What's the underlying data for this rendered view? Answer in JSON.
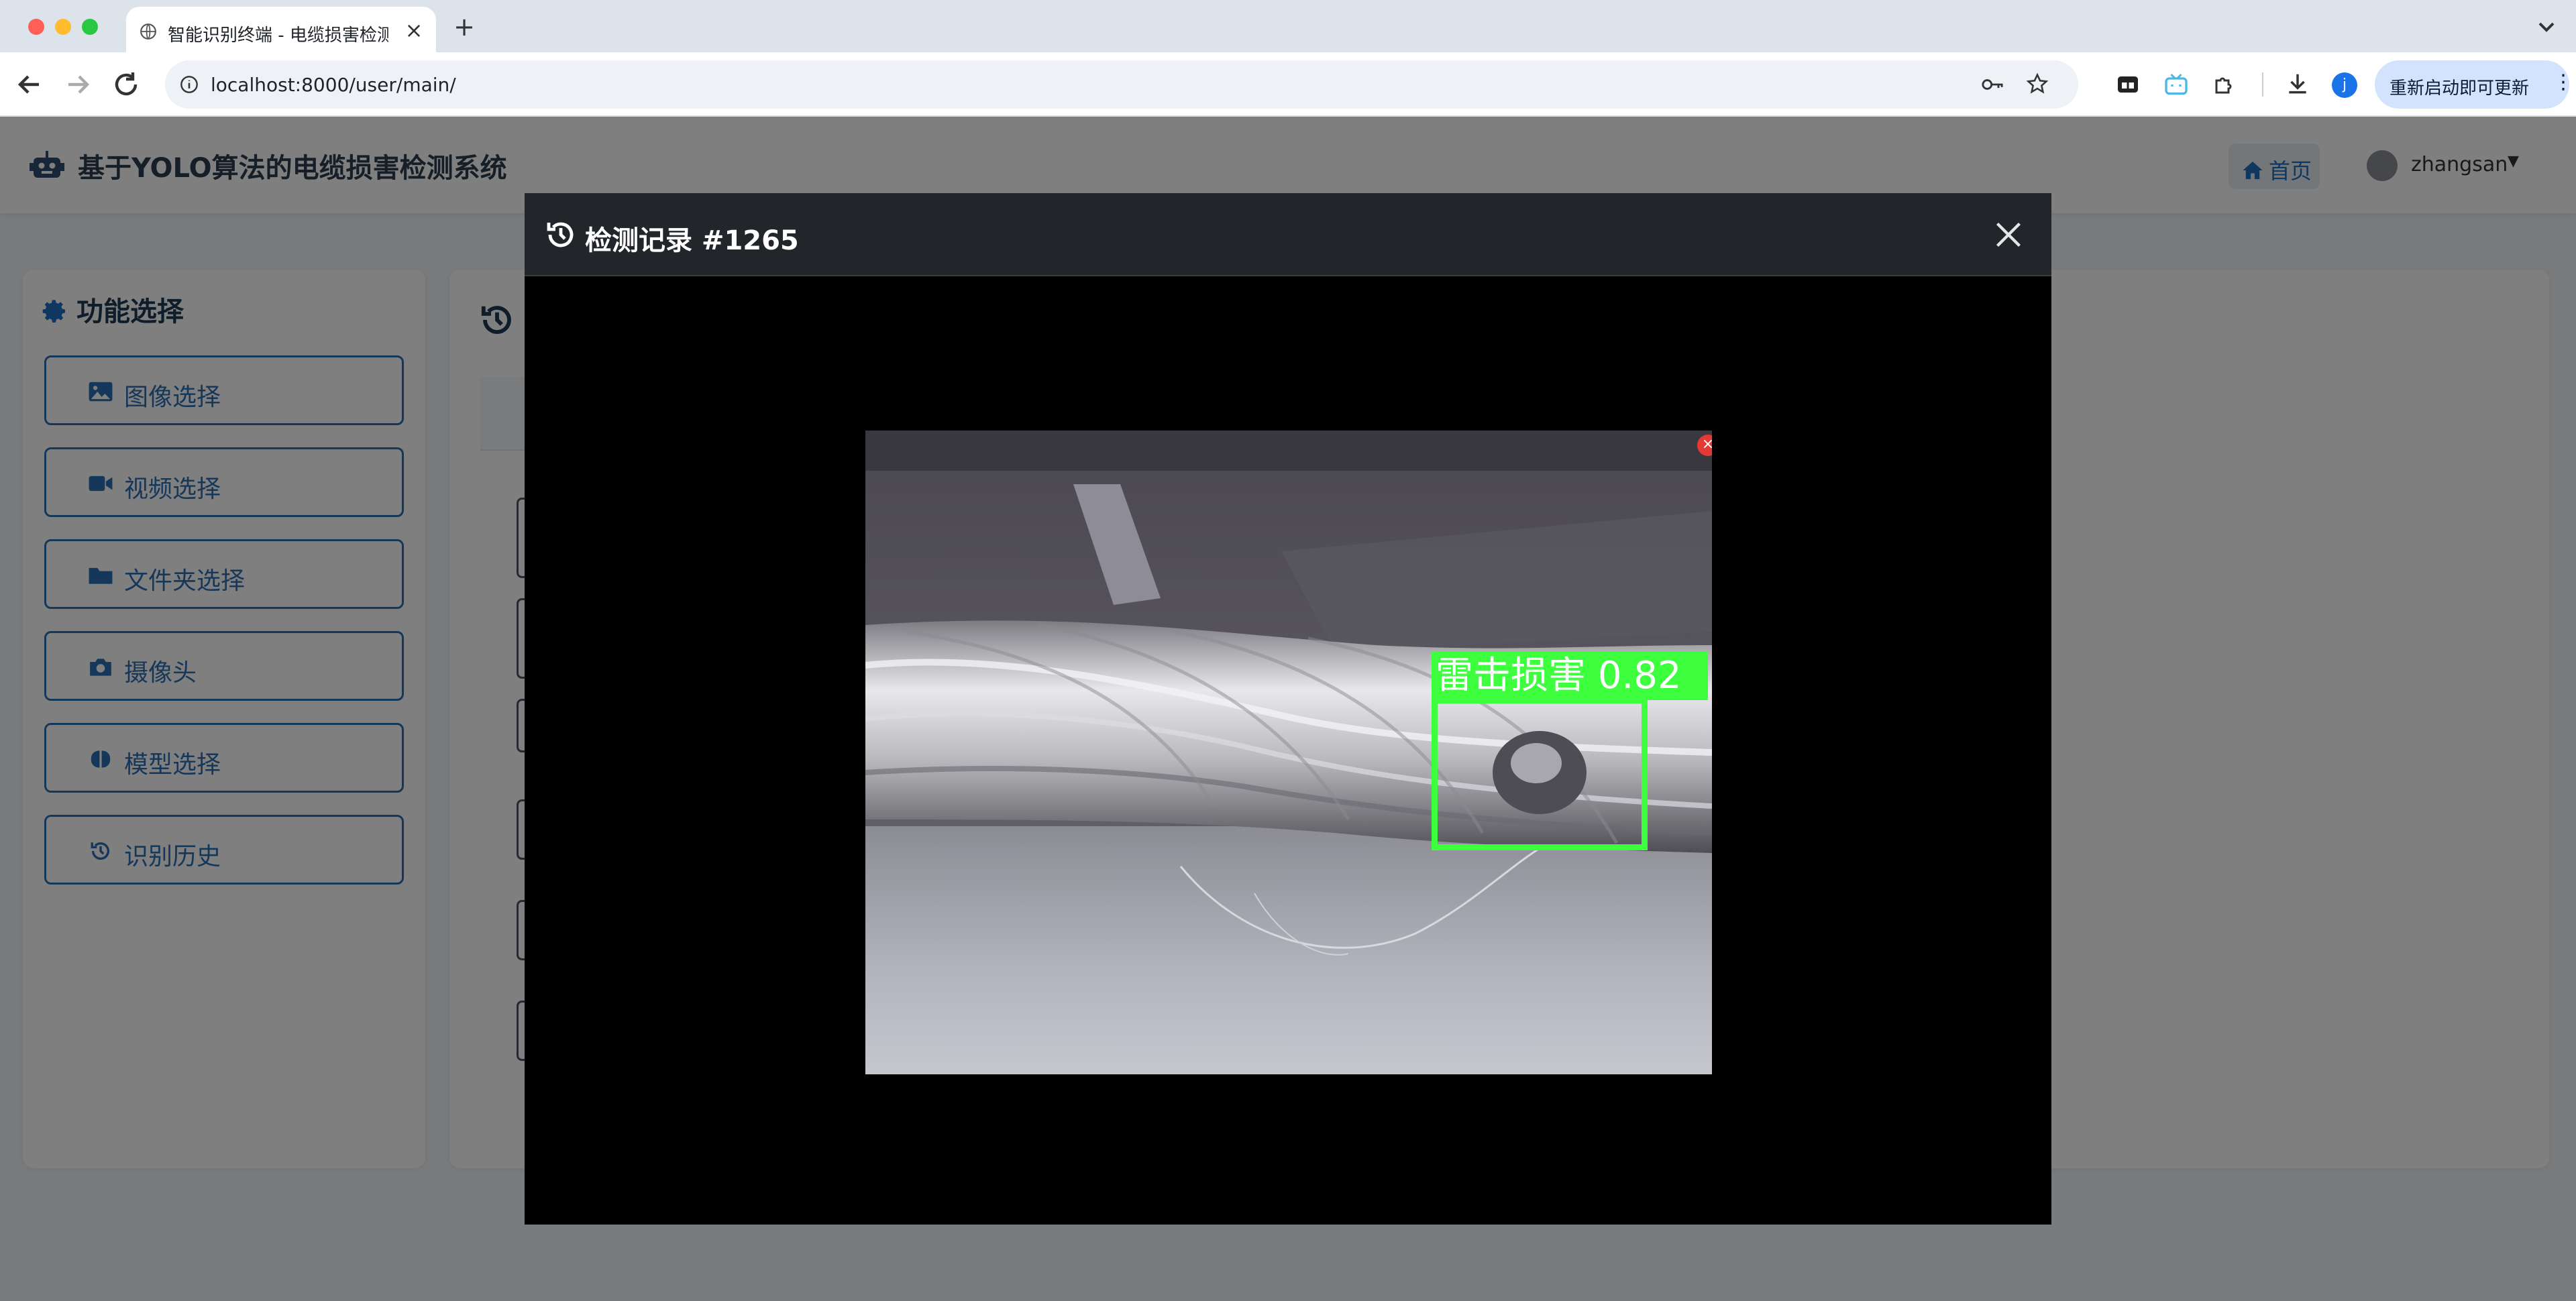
{
  "browser": {
    "tab_title": "智能识别终端 - 电缆损害检测系",
    "tab_close": "×",
    "new_tab": "+",
    "url": "localhost:8000/user/main/",
    "profile_initial": "j",
    "update_label": "重新启动即可更新",
    "update_menu": "⋮"
  },
  "header": {
    "title": "基于YOLO算法的电缆损害检测系统",
    "home_label": "首页",
    "username": "zhangsan"
  },
  "sidebar": {
    "title": "功能选择",
    "items": [
      {
        "label": "图像选择",
        "icon": "image-icon"
      },
      {
        "label": "视频选择",
        "icon": "video-icon"
      },
      {
        "label": "文件夹选择",
        "icon": "folder-icon"
      },
      {
        "label": "摄像头",
        "icon": "camera-icon"
      },
      {
        "label": "模型选择",
        "icon": "brain-icon"
      },
      {
        "label": "识别历史",
        "icon": "history-icon"
      }
    ]
  },
  "modal": {
    "title": "检测记录 #1265",
    "detection": {
      "class_label": "雷击损害",
      "confidence": "0.82",
      "box_color": "#3dff3d"
    },
    "image_close": "×"
  },
  "colors": {
    "accent": "#2a6fb5",
    "modal_header": "#22252a",
    "detection_box": "#3dff3d"
  }
}
